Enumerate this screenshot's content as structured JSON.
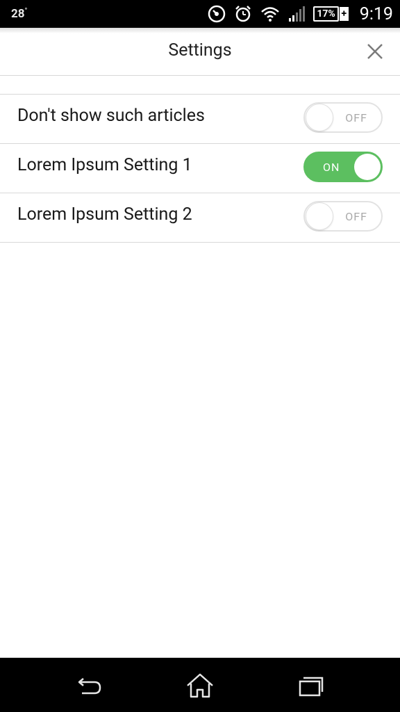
{
  "status_bar": {
    "temperature": "28",
    "battery_percent": "17%",
    "battery_charging_symbol": "+",
    "time": "9:19",
    "icons": [
      "speedometer-icon",
      "alarm-clock-icon",
      "wifi-icon",
      "signal-icon",
      "battery-icon"
    ]
  },
  "header": {
    "title": "Settings",
    "close_icon": "close-icon"
  },
  "settings": [
    {
      "label": "Don't show such articles",
      "state": "OFF",
      "on": false
    },
    {
      "label": "Lorem Ipsum Setting 1",
      "state": "ON",
      "on": true
    },
    {
      "label": "Lorem Ipsum Setting 2",
      "state": "OFF",
      "on": false
    }
  ],
  "nav_bar": {
    "icons": [
      "back-icon",
      "home-icon",
      "recent-apps-icon"
    ]
  },
  "colors": {
    "toggle_on": "#5cbf60",
    "toggle_off_border": "#e2e2e2",
    "divider": "#d8d8d8"
  }
}
